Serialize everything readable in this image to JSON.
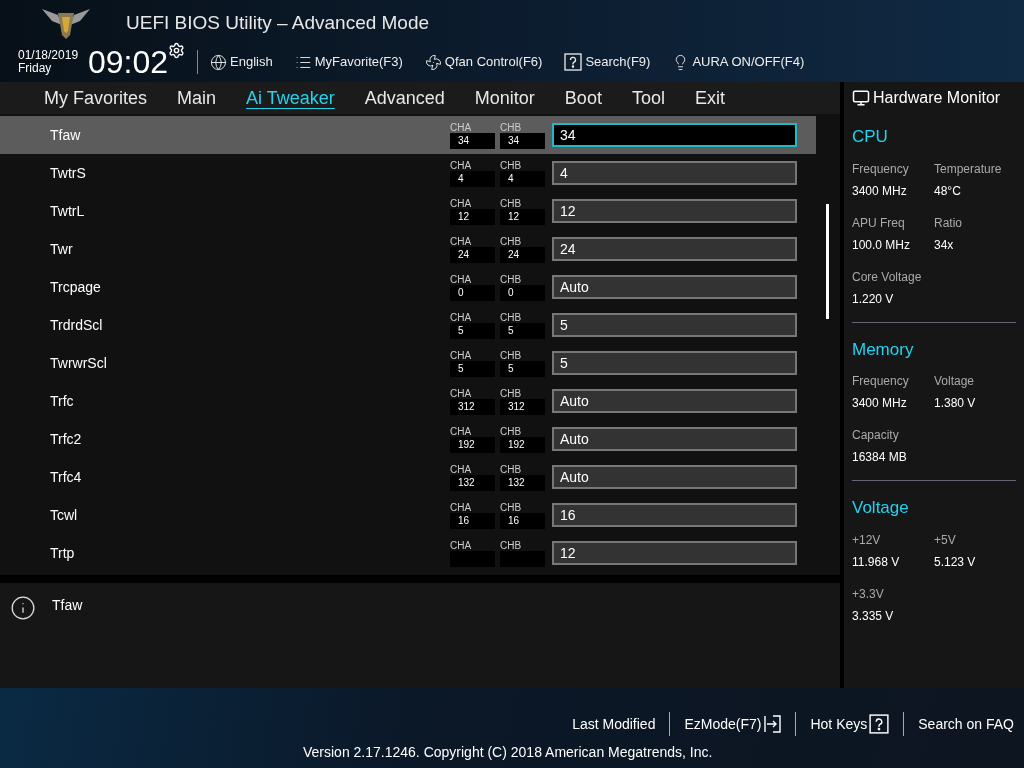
{
  "header": {
    "title": "UEFI BIOS Utility – Advanced Mode",
    "date": "01/18/2019",
    "day": "Friday",
    "time": "09:02",
    "toolbar": [
      {
        "label": "English",
        "kind": "language"
      },
      {
        "label": "MyFavorite(F3)",
        "kind": "favorite"
      },
      {
        "label": "Qfan Control(F6)",
        "kind": "fan"
      },
      {
        "label": "Search(F9)",
        "kind": "search"
      },
      {
        "label": "AURA ON/OFF(F4)",
        "kind": "aura"
      }
    ]
  },
  "tabs": [
    {
      "label": "My Favorites",
      "selected": false
    },
    {
      "label": "Main",
      "selected": false
    },
    {
      "label": "Ai Tweaker",
      "selected": true
    },
    {
      "label": "Advanced",
      "selected": false
    },
    {
      "label": "Monitor",
      "selected": false
    },
    {
      "label": "Boot",
      "selected": false
    },
    {
      "label": "Tool",
      "selected": false
    },
    {
      "label": "Exit",
      "selected": false
    }
  ],
  "settings": [
    {
      "label": "Tfaw",
      "selected": true,
      "channels": [
        {
          "label": "CHA",
          "value": "34"
        },
        {
          "label": "CHB",
          "value": "34"
        }
      ],
      "value": "34"
    },
    {
      "label": "TwtrS",
      "selected": false,
      "channels": [
        {
          "label": "CHA",
          "value": "4"
        },
        {
          "label": "CHB",
          "value": "4"
        }
      ],
      "value": "4"
    },
    {
      "label": "TwtrL",
      "selected": false,
      "channels": [
        {
          "label": "CHA",
          "value": "12"
        },
        {
          "label": "CHB",
          "value": "12"
        }
      ],
      "value": "12"
    },
    {
      "label": "Twr",
      "selected": false,
      "channels": [
        {
          "label": "CHA",
          "value": "24"
        },
        {
          "label": "CHB",
          "value": "24"
        }
      ],
      "value": "24"
    },
    {
      "label": "Trcpage",
      "selected": false,
      "channels": [
        {
          "label": "CHA",
          "value": "0"
        },
        {
          "label": "CHB",
          "value": "0"
        }
      ],
      "value": "Auto"
    },
    {
      "label": "TrdrdScl",
      "selected": false,
      "channels": [
        {
          "label": "CHA",
          "value": "5"
        },
        {
          "label": "CHB",
          "value": "5"
        }
      ],
      "value": "5"
    },
    {
      "label": "TwrwrScl",
      "selected": false,
      "channels": [
        {
          "label": "CHA",
          "value": "5"
        },
        {
          "label": "CHB",
          "value": "5"
        }
      ],
      "value": "5"
    },
    {
      "label": "Trfc",
      "selected": false,
      "channels": [
        {
          "label": "CHA",
          "value": "312"
        },
        {
          "label": "CHB",
          "value": "312"
        }
      ],
      "value": "Auto"
    },
    {
      "label": "Trfc2",
      "selected": false,
      "channels": [
        {
          "label": "CHA",
          "value": "192"
        },
        {
          "label": "CHB",
          "value": "192"
        }
      ],
      "value": "Auto"
    },
    {
      "label": "Trfc4",
      "selected": false,
      "channels": [
        {
          "label": "CHA",
          "value": "132"
        },
        {
          "label": "CHB",
          "value": "132"
        }
      ],
      "value": "Auto"
    },
    {
      "label": "Tcwl",
      "selected": false,
      "channels": [
        {
          "label": "CHA",
          "value": "16"
        },
        {
          "label": "CHB",
          "value": "16"
        }
      ],
      "value": "16"
    },
    {
      "label": "Trtp",
      "selected": false,
      "channels": [
        {
          "label": "CHA"
        },
        {
          "label": "CHB"
        }
      ],
      "value": "12"
    }
  ],
  "help": {
    "text": "Tfaw"
  },
  "hardware_monitor": {
    "title": "Hardware Monitor",
    "sections": [
      {
        "title": "CPU",
        "items": [
          {
            "label": "Frequency",
            "value": "3400 MHz"
          },
          {
            "label": "Temperature",
            "value": "48°C"
          },
          {
            "label": "APU Freq",
            "value": "100.0 MHz"
          },
          {
            "label": "Ratio",
            "value": "34x"
          },
          {
            "label": "Core Voltage",
            "value": "1.220 V"
          }
        ]
      },
      {
        "title": "Memory",
        "items": [
          {
            "label": "Frequency",
            "value": "3400 MHz"
          },
          {
            "label": "Voltage",
            "value": "1.380 V"
          },
          {
            "label": "Capacity",
            "value": "16384 MB"
          }
        ]
      },
      {
        "title": "Voltage",
        "items": [
          {
            "label": "+12V",
            "value": "11.968 V"
          },
          {
            "label": "+5V",
            "value": "5.123 V"
          },
          {
            "label": "+3.3V",
            "value": "3.335 V"
          }
        ]
      }
    ]
  },
  "footer": {
    "actions": [
      {
        "label": "Last Modified",
        "kind": "text"
      },
      {
        "label": "EzMode(F7)",
        "kind": "exit"
      },
      {
        "label": "Hot Keys",
        "kind": "help"
      },
      {
        "label": "Search on FAQ",
        "kind": "text"
      }
    ],
    "version": "Version 2.17.1246. Copyright (C) 2018 American Megatrends, Inc."
  }
}
